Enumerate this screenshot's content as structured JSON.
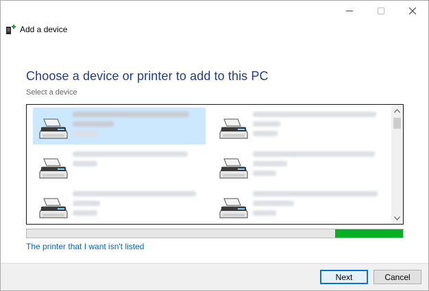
{
  "window": {
    "title": "Add a device",
    "caption_icons": [
      "minimize-icon",
      "maximize-icon",
      "close-icon"
    ]
  },
  "main": {
    "heading": "Choose a device or printer to add to this PC",
    "subheading": "Select a device"
  },
  "devices": [
    {
      "icon": "printer-icon",
      "name": "",
      "status": "",
      "selected": true
    },
    {
      "icon": "printer-icon",
      "name": "",
      "status": "",
      "selected": false
    },
    {
      "icon": "printer-icon",
      "name": "",
      "status": "",
      "selected": false
    },
    {
      "icon": "printer-icon",
      "name": "",
      "status": "",
      "selected": false
    },
    {
      "icon": "printer-icon",
      "name": "",
      "status": "",
      "selected": false
    },
    {
      "icon": "printer-icon",
      "name": "",
      "status": "",
      "selected": false
    }
  ],
  "search_progress": 0.18,
  "link_text": "The printer that I want isn't listed",
  "buttons": {
    "next": "Next",
    "cancel": "Cancel"
  },
  "colors": {
    "heading": "#1e3c96",
    "link": "#0066cc",
    "progress": "#06b025",
    "selection": "#cce8ff",
    "default_button_border": "#0078d7"
  }
}
